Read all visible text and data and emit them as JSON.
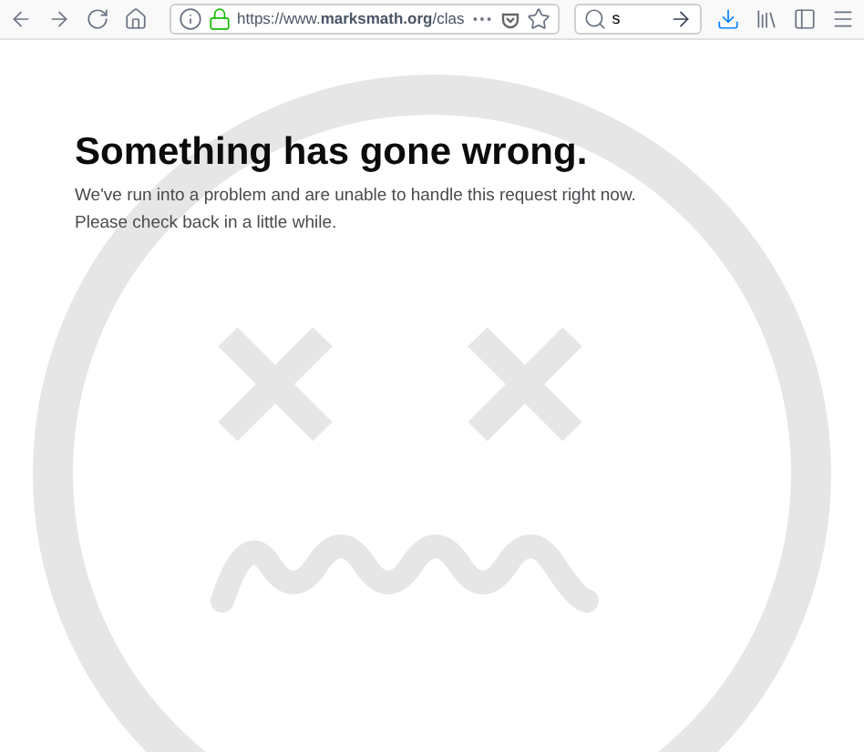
{
  "toolbar": {
    "url": "https://www.**marksmath.org**/clas",
    "search": {
      "value": "s"
    }
  },
  "error": {
    "title": "Something has gone wrong.",
    "lines": [
      "We've run into a problem and are unable to handle this request right now.",
      "Please check back in a little while."
    ]
  }
}
